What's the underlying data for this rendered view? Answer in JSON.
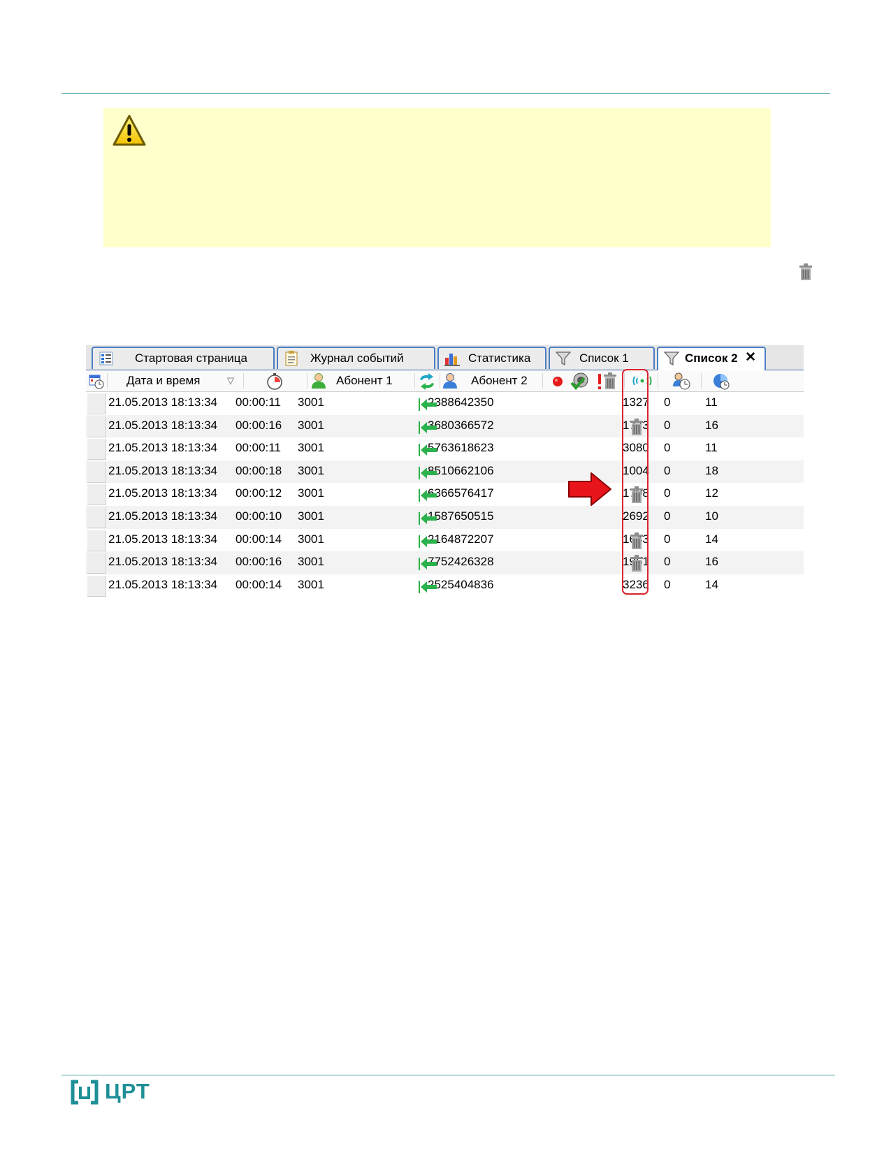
{
  "tabs": [
    {
      "label": "Стартовая страница",
      "icon": "start-page-icon"
    },
    {
      "label": "Журнал событий",
      "icon": "event-log-icon"
    },
    {
      "label": "Статистика",
      "icon": "statistics-icon"
    },
    {
      "label": "Список 1",
      "icon": "filter-icon"
    },
    {
      "label": "Список 2",
      "icon": "filter-icon",
      "close": "✕"
    }
  ],
  "columns": {
    "datetime": "Дата и время",
    "sort_indicator": "▽",
    "subscriber1": "Абонент 1",
    "subscriber2": "Абонент 2"
  },
  "rows": [
    {
      "datetime": "21.05.2013 18:13:34",
      "duration": "00:00:11",
      "sub1": "3001",
      "sub2": "2388642350",
      "deleted": false,
      "c1": "1327",
      "c2": "0",
      "c3": "11"
    },
    {
      "datetime": "21.05.2013 18:13:34",
      "duration": "00:00:16",
      "sub1": "3001",
      "sub2": "3680366572",
      "deleted": true,
      "c1": "1773",
      "c2": "0",
      "c3": "16"
    },
    {
      "datetime": "21.05.2013 18:13:34",
      "duration": "00:00:11",
      "sub1": "3001",
      "sub2": "5763618623",
      "deleted": false,
      "c1": "3080",
      "c2": "0",
      "c3": "11"
    },
    {
      "datetime": "21.05.2013 18:13:34",
      "duration": "00:00:18",
      "sub1": "3001",
      "sub2": "8510662106",
      "deleted": false,
      "c1": "1004",
      "c2": "0",
      "c3": "18"
    },
    {
      "datetime": "21.05.2013 18:13:34",
      "duration": "00:00:12",
      "sub1": "3001",
      "sub2": "6366576417",
      "deleted": true,
      "c1": "1798",
      "c2": "0",
      "c3": "12"
    },
    {
      "datetime": "21.05.2013 18:13:34",
      "duration": "00:00:10",
      "sub1": "3001",
      "sub2": "1587650515",
      "deleted": false,
      "c1": "2692",
      "c2": "0",
      "c3": "10"
    },
    {
      "datetime": "21.05.2013 18:13:34",
      "duration": "00:00:14",
      "sub1": "3001",
      "sub2": "2164872207",
      "deleted": true,
      "c1": "1643",
      "c2": "0",
      "c3": "14"
    },
    {
      "datetime": "21.05.2013 18:13:34",
      "duration": "00:00:16",
      "sub1": "3001",
      "sub2": "7752426328",
      "deleted": true,
      "c1": "1961",
      "c2": "0",
      "c3": "16"
    },
    {
      "datetime": "21.05.2013 18:13:34",
      "duration": "00:00:14",
      "sub1": "3001",
      "sub2": "2525404836",
      "deleted": false,
      "c1": "3236",
      "c2": "0",
      "c3": "14"
    }
  ],
  "footer": {
    "logo_text": "ЦРТ"
  },
  "colors": {
    "rule": "#4fa3a8",
    "warning_bg": "#ffffcc",
    "highlight": "#d9232d",
    "brand": "#1e8f96"
  }
}
